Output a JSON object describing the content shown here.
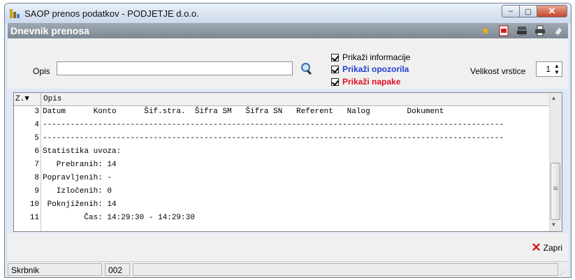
{
  "window": {
    "title": "SAOP prenos podatkov - PODJETJE d.o.o.",
    "minimize_label": "–",
    "maximize_label": "▢",
    "close_label": "✕"
  },
  "subheader": {
    "title": "Dnevnik prenosa"
  },
  "toolbar": {
    "icons": [
      "star-icon",
      "export-icon",
      "stamp-icon",
      "print-icon",
      "eraser-icon"
    ]
  },
  "filter": {
    "opis_label": "Opis",
    "opis_value": "",
    "checkbox_info": "Prikaži informacije",
    "checkbox_warnings": "Prikaži opozorila",
    "checkbox_errors": "Prikaži napake",
    "row_size_label": "Velikost vrstice",
    "row_size_value": "1"
  },
  "grid": {
    "col_z": "Z.▼",
    "col_opis": "Opis",
    "rows": [
      {
        "n": "3",
        "t": "Datum      Konto      Šif.stra.  Šifra SM   Šifra SN   Referent   Nalog        Dokument"
      },
      {
        "n": "4",
        "t": "----------------------------------------------------------------------------------------------------"
      },
      {
        "n": "5",
        "t": "----------------------------------------------------------------------------------------------------"
      },
      {
        "n": "6",
        "t": "Statistika uvoza:"
      },
      {
        "n": "7",
        "t": "   Prebranih: 14"
      },
      {
        "n": "8",
        "t": "Popravljenih: -"
      },
      {
        "n": "9",
        "t": "   Izločenih: 0"
      },
      {
        "n": "10",
        "t": " Poknjiženih: 14"
      },
      {
        "n": "11",
        "t": "         Čas: 14:29:30 - 14:29:30"
      }
    ]
  },
  "bottom": {
    "close_label": "Zapri"
  },
  "status": {
    "user": "Skrbnik",
    "code": "002",
    "extra": ""
  },
  "colors": {
    "subheader_bg": "#8a959f",
    "warning_text": "#1f3fd0",
    "error_text": "#e01020",
    "close_button": "#c7462c"
  }
}
